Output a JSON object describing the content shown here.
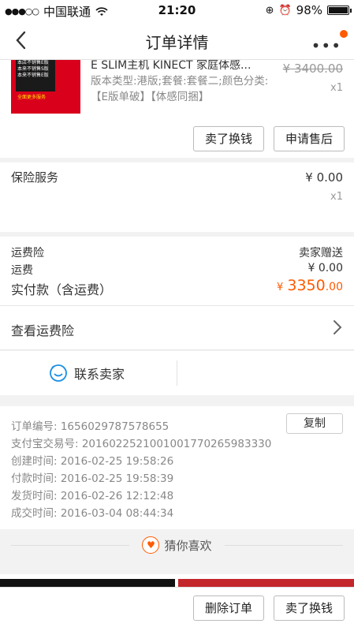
{
  "status_bar": {
    "carrier": "中国联通",
    "time": "21:20",
    "battery": "98%"
  },
  "nav": {
    "title": "订单详情"
  },
  "product": {
    "title": "E SLIM主机 KINECT 家庭体感...",
    "spec": "版本类型:港版;套餐:套餐二;颜色分类:【E版单破】【体感同捆】",
    "original_price": "¥ 3400.00",
    "quantity": "x1",
    "thumb_texts": [
      "本店不销售E版",
      "本来不销售S版",
      "本来不销售E版",
      "全面更多服务"
    ],
    "buttons": {
      "exchange": "卖了换钱",
      "after_sale": "申请售后"
    }
  },
  "insurance": {
    "label": "保险服务",
    "price": "¥ 0.00",
    "quantity": "x1"
  },
  "fees": {
    "shipping_insurance_label": "运费险",
    "shipping_insurance_value": "卖家赠送",
    "shipping_label": "运费",
    "shipping_value": "¥ 0.00",
    "total_label": "实付款（含运费）",
    "total_currency": "¥",
    "total_int": "3350",
    "total_dec": ".00"
  },
  "freight_insurance": {
    "label": "查看运费险"
  },
  "contact": {
    "label": "联系卖家"
  },
  "order_info": {
    "order_no": "订单编号:  1656029787578655",
    "alipay_no": "支付宝交易号:  2016022521001001770265983330",
    "created": "创建时间:  2016-02-25 19:58:26",
    "paid": "付款时间:  2016-02-25 19:58:39",
    "shipped": "发货时间:  2016-02-26 12:12:48",
    "completed": "成交时间:  2016-03-04 08:44:34",
    "copy_label": "复制"
  },
  "guess": {
    "label": "猜你喜欢"
  },
  "bottom": {
    "delete": "删除订单",
    "exchange": "卖了换钱"
  }
}
